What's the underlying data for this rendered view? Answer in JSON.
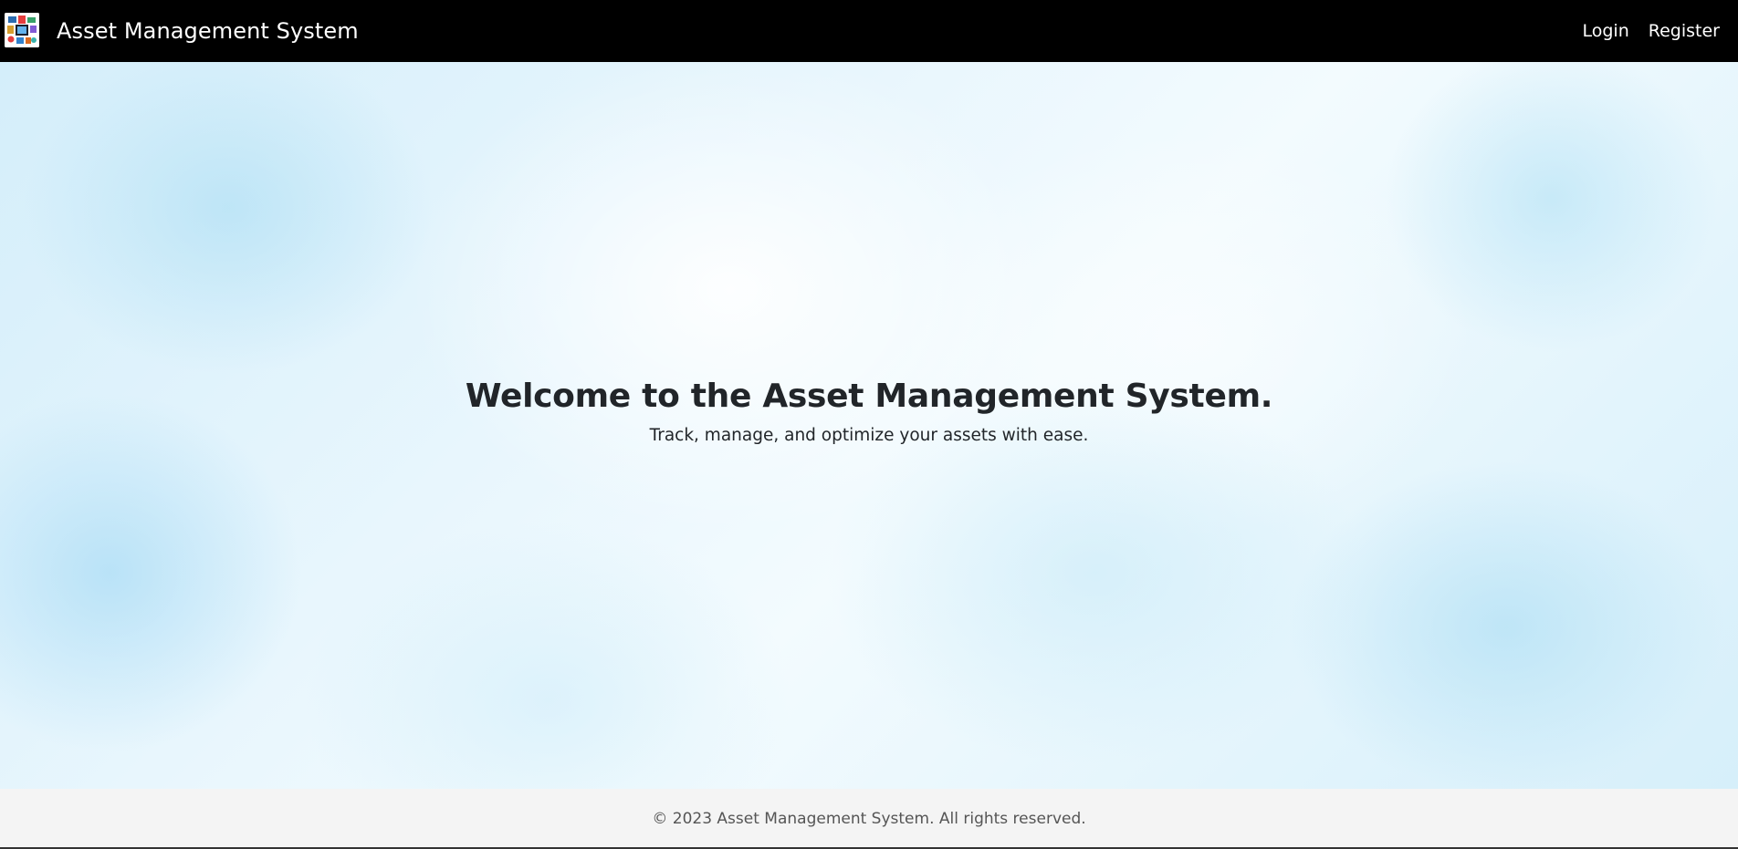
{
  "navbar": {
    "logo_icon": "asset-collage-logo-icon",
    "title": "Asset Management System",
    "links": [
      {
        "label": "Login"
      },
      {
        "label": "Register"
      }
    ]
  },
  "hero": {
    "title": "Welcome to the Asset Management System.",
    "subtitle": "Track, manage, and optimize your assets with ease."
  },
  "footer": {
    "text": "© 2023 Asset Management System. All rights reserved."
  },
  "colors": {
    "navbar_bg": "#000000",
    "navbar_text": "#ffffff",
    "hero_bg": "#e4f5fc",
    "heading_text": "#212529",
    "footer_bg": "#f4f4f4",
    "footer_text": "#555555"
  }
}
